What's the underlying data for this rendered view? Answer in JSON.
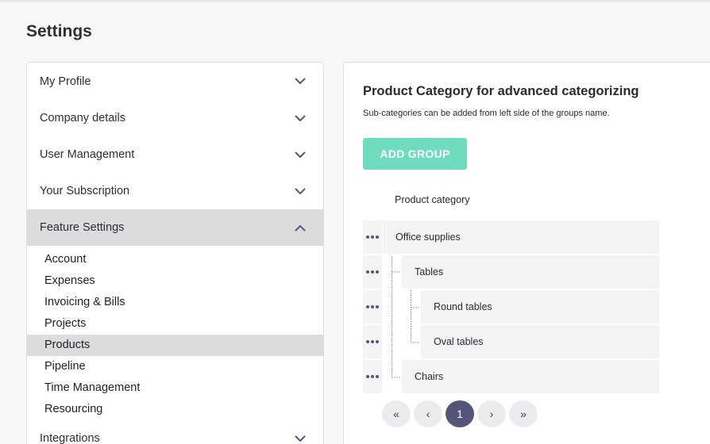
{
  "page": {
    "title": "Settings"
  },
  "accordion": {
    "sections": [
      {
        "label": "My Profile",
        "open": false
      },
      {
        "label": "Company details",
        "open": false
      },
      {
        "label": "User Management",
        "open": false
      },
      {
        "label": "Your Subscription",
        "open": false
      },
      {
        "label": "Feature Settings",
        "open": true
      },
      {
        "label": "Integrations",
        "open": false
      }
    ],
    "feature_items": [
      "Account",
      "Expenses",
      "Invoicing & Bills",
      "Projects",
      "Products",
      "Pipeline",
      "Time Management",
      "Resourcing"
    ],
    "active_item": "Products"
  },
  "panel": {
    "title": "Product Category for advanced categorizing",
    "description": "Sub-categories can be added from left side of the groups name.",
    "add_button": "ADD GROUP",
    "column_header": "Product category",
    "tree": [
      {
        "label": "Office supplies",
        "level": 0
      },
      {
        "label": "Tables",
        "level": 1
      },
      {
        "label": "Round tables",
        "level": 2
      },
      {
        "label": "Oval tables",
        "level": 2
      },
      {
        "label": "Chairs",
        "level": 1
      }
    ]
  },
  "pagination": {
    "first": "«",
    "prev": "‹",
    "current": "1",
    "next": "›",
    "last": "»"
  },
  "colors": {
    "accent": "#6fdcbf",
    "pager_active": "#55557a",
    "selected_bg": "#dcdcdc"
  }
}
